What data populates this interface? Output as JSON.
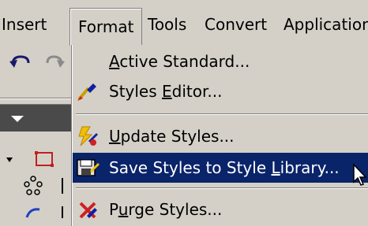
{
  "menubar": {
    "items": [
      {
        "label": "Insert"
      },
      {
        "label": "Format"
      },
      {
        "label": "Tools"
      },
      {
        "label": "Convert"
      },
      {
        "label": "Applications"
      }
    ]
  },
  "format_menu": {
    "items": [
      {
        "label": "Active Standard...",
        "icon": ""
      },
      {
        "label": "Styles Editor...",
        "icon": "paintbrush-icon"
      },
      {
        "label": "Update Styles...",
        "icon": "lightning-paint-icon"
      },
      {
        "label": "Save Styles to Style Library...",
        "icon": "save-styles-icon"
      },
      {
        "label": "Purge Styles...",
        "icon": "purge-styles-icon"
      }
    ],
    "highlighted_index": 3,
    "highlight_color": "#0a246a"
  },
  "colors": {
    "menu_background": "#d4d0c8",
    "highlight_text": "#ffffff"
  }
}
